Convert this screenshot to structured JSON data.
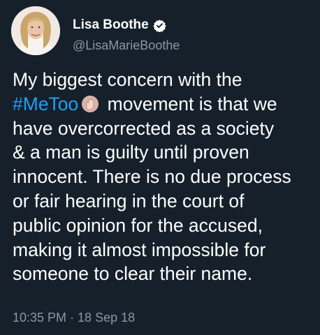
{
  "user": {
    "display_name": "Lisa Boothe",
    "handle": "@LisaMarieBoothe",
    "verified_icon": "verified-badge-icon"
  },
  "tweet": {
    "line1": "My biggest concern with the",
    "hashtag": "#MeToo",
    "hashtag_emoji": "raised-hand-icon",
    "line2_rest": " movement is that we",
    "line3": "have overcorrected as a society",
    "line4": "& a man is guilty until proven",
    "line5": "innocent. There is no due process",
    "line6": "or fair hearing in the court of",
    "line7": "public opinion for the accused,",
    "line8": "making it almost impossible for",
    "line9": "someone to clear their name."
  },
  "meta": {
    "timestamp": "10:35 PM · 18 Sep 18"
  },
  "colors": {
    "background": "#15202b",
    "text": "#ffffff",
    "secondary": "#8899a6",
    "hashtag": "#1da1f2"
  }
}
